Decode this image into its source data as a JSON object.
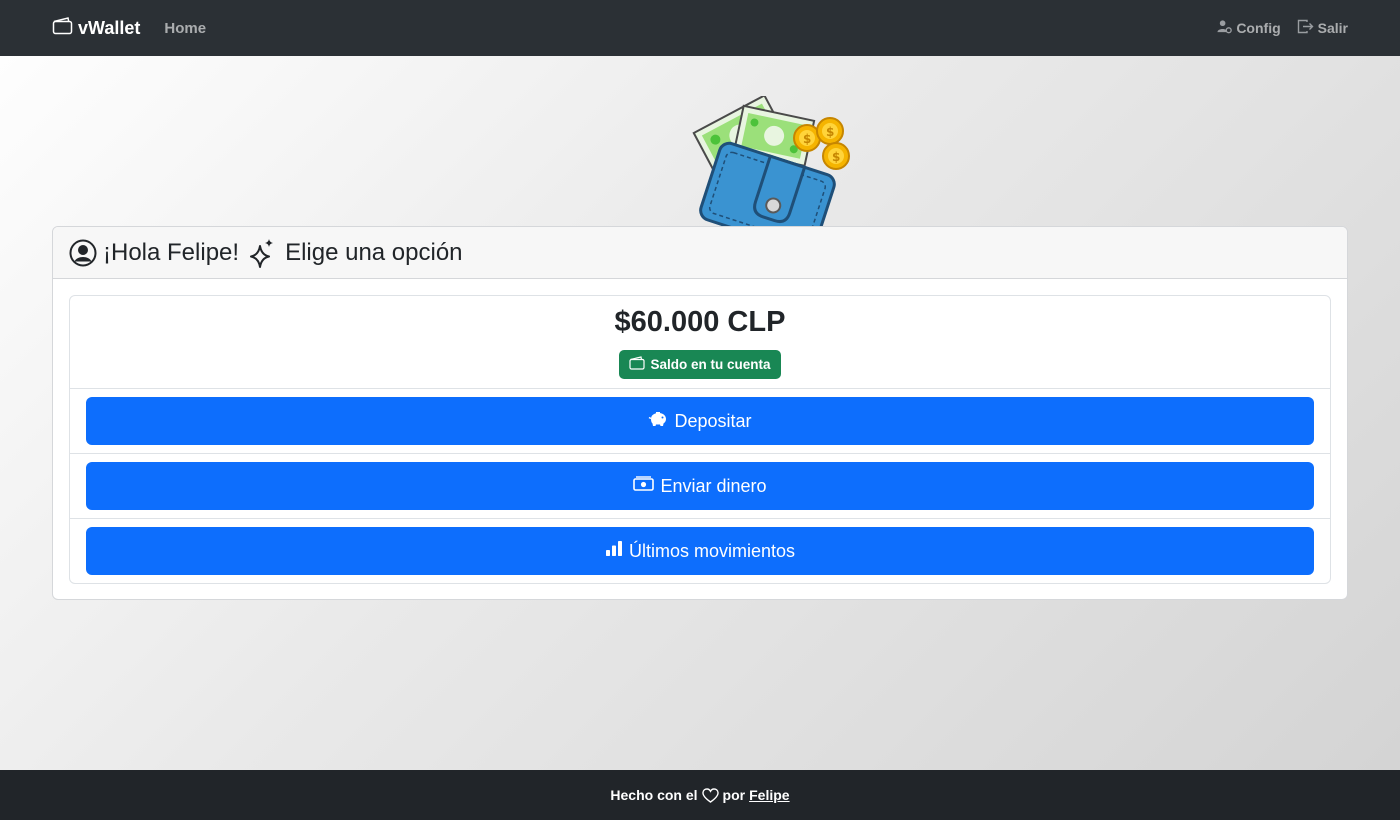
{
  "navbar": {
    "brand": "vWallet",
    "home": "Home",
    "config": "Config",
    "logout": "Salir",
    "icons": {
      "brand": "wallet-icon",
      "config": "user-gear-icon",
      "logout": "box-arrow-right-icon"
    }
  },
  "hero": {
    "image": "wallet-with-money-illustration"
  },
  "card": {
    "greeting": "¡Hola Felipe!",
    "prompt": "Elige una opción",
    "icons": {
      "user": "person-circle-icon",
      "sparkle": "stars-icon"
    }
  },
  "balance": {
    "amount": "$60.000 CLP",
    "badge": "Saldo en tu cuenta",
    "badge_color": "#198754"
  },
  "actions": [
    {
      "label": "Depositar",
      "icon": "piggy-bank-icon"
    },
    {
      "label": "Enviar dinero",
      "icon": "cash-icon"
    },
    {
      "label": "Últimos movimientos",
      "icon": "bar-chart-icon"
    }
  ],
  "footer": {
    "text_before": "Hecho con el",
    "text_middle": "por",
    "author": "Felipe"
  },
  "colors": {
    "navbar": "#2b3035",
    "primary": "#0d6efd",
    "success": "#198754",
    "footer": "#212529"
  }
}
